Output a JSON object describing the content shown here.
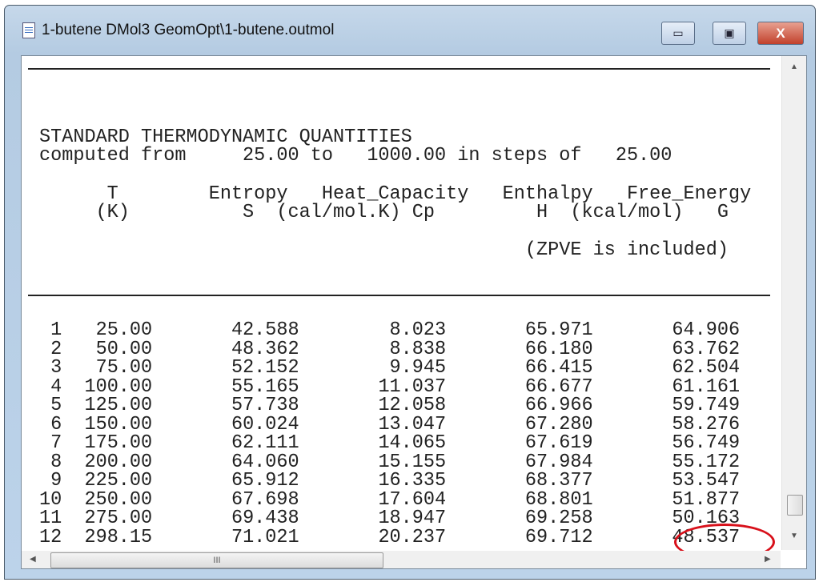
{
  "window": {
    "title": "1-butene DMol3 GeomOpt\\1-butene.outmol",
    "minimize": "▭",
    "maximize": "▣",
    "close": "X"
  },
  "output": {
    "heading": "STANDARD THERMODYNAMIC QUANTITIES",
    "computed": "computed from     25.00 to   1000.00 in steps of   25.00",
    "col_header_1": "      T        Entropy   Heat_Capacity   Enthalpy   Free_Energy",
    "col_header_2": "     (K)          S  (cal/mol.K) Cp         H  (kcal/mol)   G",
    "zpve_note": "                                           (ZPVE is included)",
    "rows": [
      [
        "1",
        "25.00",
        "42.588",
        "8.023",
        "65.971",
        "64.906"
      ],
      [
        "2",
        "50.00",
        "48.362",
        "8.838",
        "66.180",
        "63.762"
      ],
      [
        "3",
        "75.00",
        "52.152",
        "9.945",
        "66.415",
        "62.504"
      ],
      [
        "4",
        "100.00",
        "55.165",
        "11.037",
        "66.677",
        "61.161"
      ],
      [
        "5",
        "125.00",
        "57.738",
        "12.058",
        "66.966",
        "59.749"
      ],
      [
        "6",
        "150.00",
        "60.024",
        "13.047",
        "67.280",
        "58.276"
      ],
      [
        "7",
        "175.00",
        "62.111",
        "14.065",
        "67.619",
        "56.749"
      ],
      [
        "8",
        "200.00",
        "64.060",
        "15.155",
        "67.984",
        "55.172"
      ],
      [
        "9",
        "225.00",
        "65.912",
        "16.335",
        "68.377",
        "53.547"
      ],
      [
        "10",
        "250.00",
        "67.698",
        "17.604",
        "68.801",
        "51.877"
      ],
      [
        "11",
        "275.00",
        "69.438",
        "18.947",
        "69.258",
        "50.163"
      ],
      [
        "12",
        "298.15",
        "71.021",
        "20.237",
        "69.712",
        "48.537"
      ]
    ],
    "highlighted_value": "48.537"
  },
  "scrollbar": {
    "h_thumb": "III",
    "up": "▲",
    "down": "▼",
    "left": "◀",
    "right": "▶"
  },
  "colors": {
    "highlight": "#d8101a"
  }
}
